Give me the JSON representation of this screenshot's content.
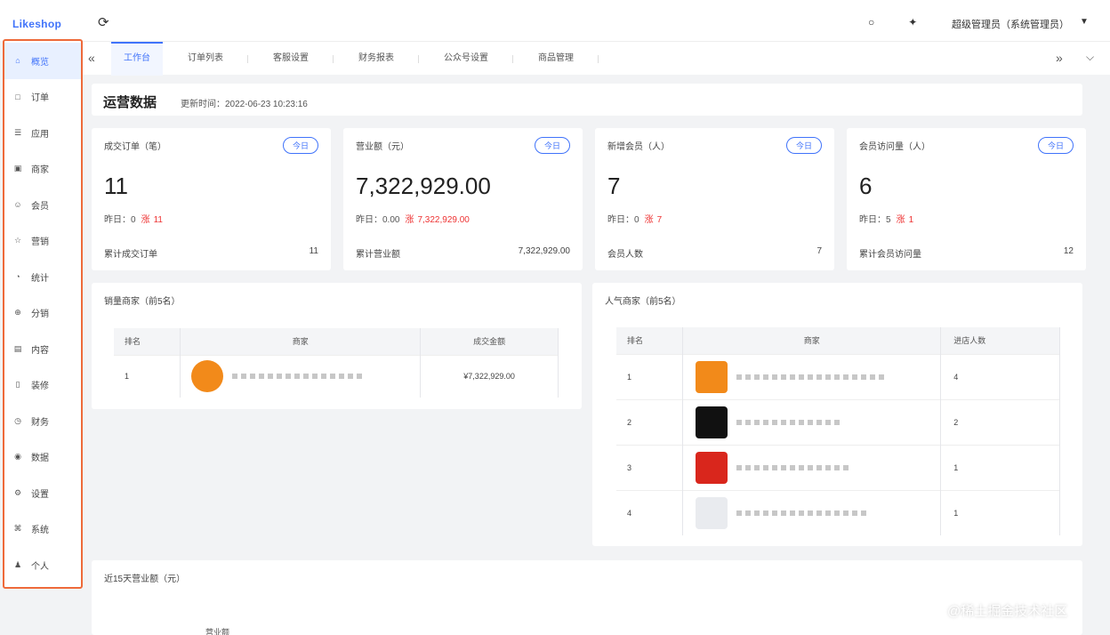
{
  "header": {
    "logo": "Likeshop",
    "refresh_icon": "refresh-icon",
    "bell_icon": "bell-icon",
    "fullscreen_icon": "fullscreen-icon",
    "user": "超级管理员（系统管理员）"
  },
  "sidebar": {
    "items": [
      {
        "label": "概览",
        "icon": "home-icon",
        "active": true
      },
      {
        "label": "订单",
        "icon": "order-icon"
      },
      {
        "label": "应用",
        "icon": "app-icon"
      },
      {
        "label": "商家",
        "icon": "shop-icon"
      },
      {
        "label": "会员",
        "icon": "user-icon"
      },
      {
        "label": "营销",
        "icon": "marketing-icon"
      },
      {
        "label": "统计",
        "icon": "stats-icon"
      },
      {
        "label": "分销",
        "icon": "distribution-icon"
      },
      {
        "label": "内容",
        "icon": "content-icon"
      },
      {
        "label": "装修",
        "icon": "decorate-icon"
      },
      {
        "label": "财务",
        "icon": "finance-icon"
      },
      {
        "label": "数据",
        "icon": "data-icon"
      },
      {
        "label": "设置",
        "icon": "settings-icon"
      },
      {
        "label": "系统",
        "icon": "system-icon"
      },
      {
        "label": "个人",
        "icon": "person-icon"
      }
    ]
  },
  "tabs": [
    "工作台",
    "订单列表",
    "客服设置",
    "财务报表",
    "公众号设置",
    "商品管理"
  ],
  "overview": {
    "title": "运营数据",
    "update_time": "更新时间：2022-06-23 10:23:16"
  },
  "cards": [
    {
      "title": "成交订单（笔）",
      "badge": "今日",
      "value": "11",
      "yesterday": "昨日：0",
      "delta_label": "涨",
      "delta": "11",
      "footer_label": "累计成交订单",
      "footer_value": "11"
    },
    {
      "title": "营业额（元）",
      "badge": "今日",
      "value": "7,322,929.00",
      "yesterday": "昨日：0.00",
      "delta_label": "涨",
      "delta": "7,322,929.00",
      "footer_label": "累计营业额",
      "footer_value": "7,322,929.00"
    },
    {
      "title": "新增会员（人）",
      "badge": "今日",
      "value": "7",
      "yesterday": "昨日：0",
      "delta_label": "涨",
      "delta": "7",
      "footer_label": "会员人数",
      "footer_value": "7"
    },
    {
      "title": "会员访问量（人）",
      "badge": "今日",
      "value": "6",
      "yesterday": "昨日：5",
      "delta_label": "涨",
      "delta": "1",
      "footer_label": "累计会员访问量",
      "footer_value": "12"
    }
  ],
  "sales_rank": {
    "title": "销量商家（前5名）",
    "headers": [
      "排名",
      "商家",
      "成交金额"
    ],
    "rows": [
      {
        "rank": "1",
        "amount": "¥7,322,929.00"
      }
    ]
  },
  "popular_rank": {
    "title": "人气商家（前5名）",
    "headers": [
      "排名",
      "商家",
      "进店人数"
    ],
    "rows": [
      {
        "rank": "1",
        "count": "4"
      },
      {
        "rank": "2",
        "count": "2"
      },
      {
        "rank": "3",
        "count": "1"
      },
      {
        "rank": "4",
        "count": "1"
      }
    ]
  },
  "revenue_chart": {
    "title": "近15天营业额（元）",
    "legend": "营业额"
  },
  "watermark": "@稀土掘金技术社区",
  "colors": {
    "accent": "#4073fa",
    "sidebar_highlight": "#ee6a3a",
    "increase": "#e33333"
  }
}
